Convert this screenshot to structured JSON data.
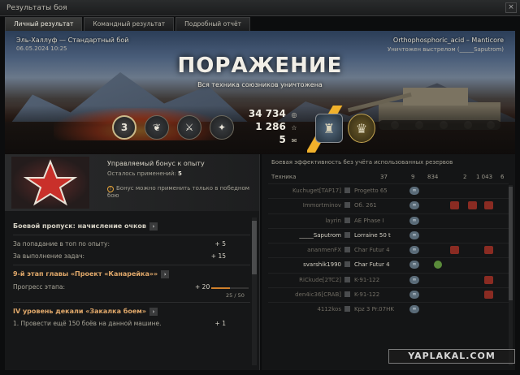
{
  "window": {
    "title": "Результаты боя",
    "close": "×"
  },
  "tabs": [
    "Личный результат",
    "Командный результат",
    "Подробный отчёт"
  ],
  "banner": {
    "map": "Эль-Халлуф — Стандартный бой",
    "date": "06.05.2024 10:25",
    "player": "Orthophosphoric_acid – Manticore",
    "killed_by": "Уничтожен выстрелом (_____Saputrom)",
    "result": "ПОРАЖЕНИЕ",
    "result_sub": "Вся техника союзников уничтожена"
  },
  "stats": {
    "rank": "3",
    "credits": "34 734",
    "experience": "1 286",
    "free_xp": "5",
    "icon_names": [
      "credits-icon",
      "star-icon",
      "free-xp-icon"
    ]
  },
  "bonus": {
    "title": "Управляемый бонус к опыту",
    "left_label": "Осталось применений:",
    "left_value": "5",
    "note": "Бонус можно применить только в победном бою"
  },
  "battlepass": {
    "title": "Боевой пропуск: начисление очков",
    "items": [
      {
        "label": "За попадание в топ по опыту:",
        "value": "+ 5"
      },
      {
        "label": "За выполнение задач:",
        "value": "+ 15"
      }
    ]
  },
  "chapter": {
    "title": "9-й этап главы «Проект «Канарейка»»",
    "progress_label": "Прогресс этапа:",
    "progress_value": "+ 20",
    "progress_count": "25 / 50",
    "progress_fraction": 0.5
  },
  "decal": {
    "title": "IV уровень декали «Закалка боем»",
    "item_label": "1. Провести ещё 150 боёв на данной машине.",
    "item_value": "+ 1"
  },
  "right": {
    "title": "Боевая эффективность без учёта использованных резервов",
    "col_tech": "Техника",
    "cols": [
      "37",
      "9",
      "834",
      "2",
      "1 043",
      "6"
    ],
    "rows": [
      {
        "player": "Kuchuget[TAP17]",
        "tank": "Progetto 65",
        "alive": false,
        "eff": "∞",
        "marks": []
      },
      {
        "player": "Immortminov",
        "tank": "Об. 261",
        "alive": false,
        "eff": "∞",
        "marks": [
          "m1",
          "m2",
          "m3"
        ]
      },
      {
        "player": "layrin",
        "tank": "AE Phase I",
        "alive": false,
        "eff": "∞",
        "marks": []
      },
      {
        "player": "_____Saputrom",
        "tank": "Lorraine 50 t",
        "alive": true,
        "eff": "∞",
        "marks": []
      },
      {
        "player": "ananmenFX",
        "tank": "Char Futur 4",
        "alive": false,
        "eff": "∞",
        "marks": [
          "m1",
          "m3"
        ]
      },
      {
        "player": "svarshik1990",
        "tank": "Char Futur 4",
        "alive": true,
        "eff": "∞",
        "marks": []
      },
      {
        "player": "RiCkude[2TC2]",
        "tank": "K-91-122",
        "alive": false,
        "eff": "∞",
        "marks": [
          "m3"
        ]
      },
      {
        "player": "den4ic36[CRAB]",
        "tank": "K-91-122",
        "alive": false,
        "eff": "∞",
        "marks": [
          "m3"
        ]
      },
      {
        "player": "4112kos",
        "tank": "Kpz 3 Pr.07HK",
        "alive": false,
        "eff": "∞",
        "marks": []
      }
    ]
  },
  "watermark": "YAPLAKAL.COM"
}
